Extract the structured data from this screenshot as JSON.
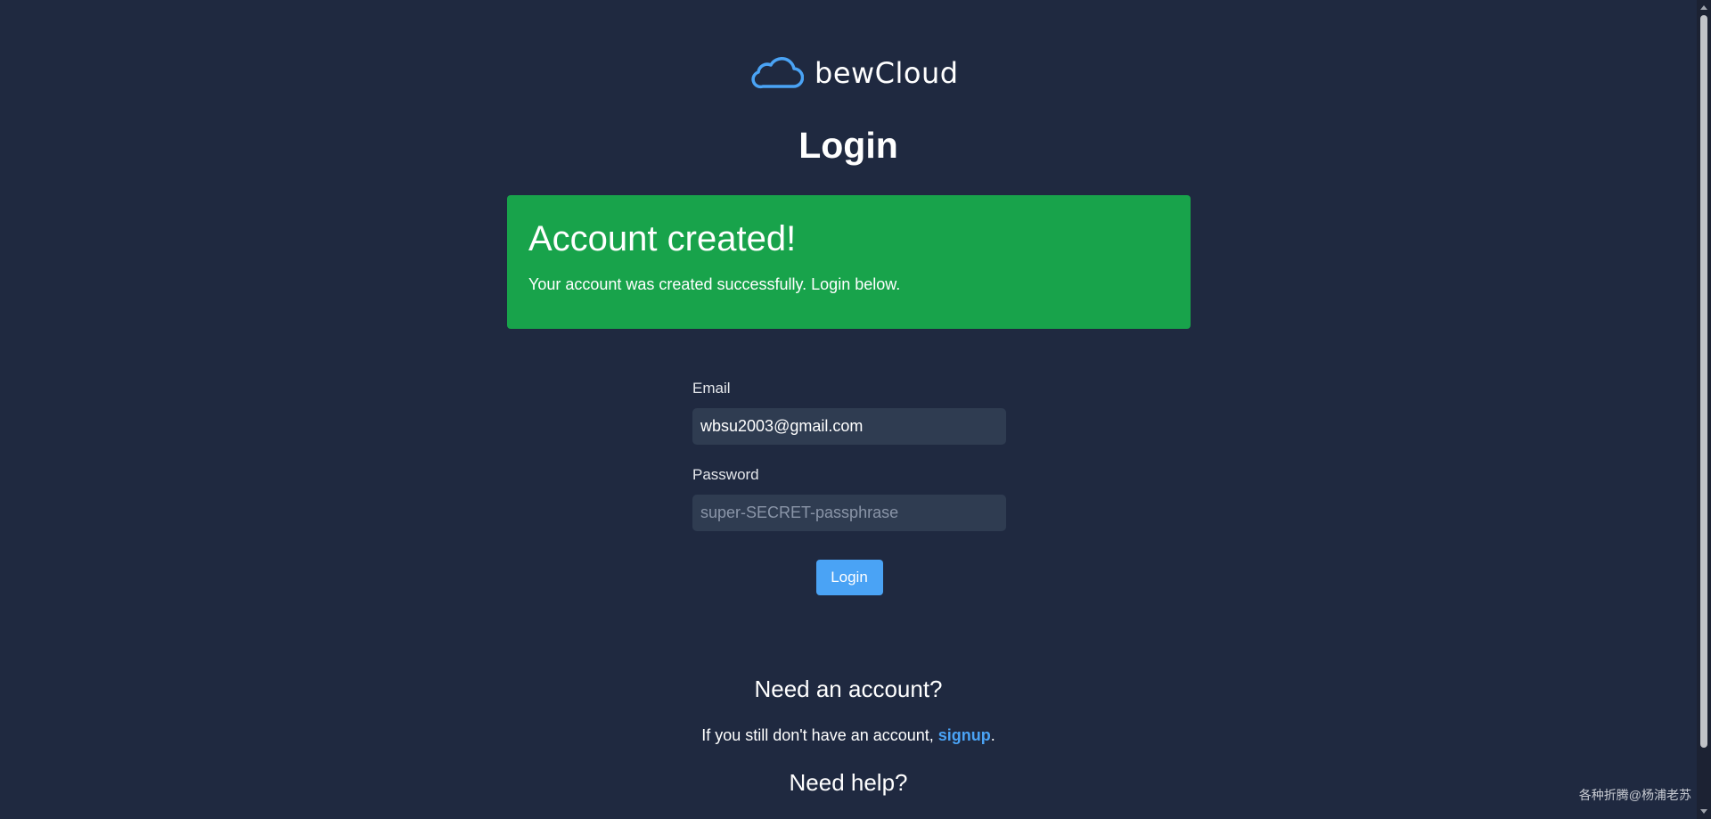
{
  "app": {
    "name": "bewCloud",
    "logo_icon": "cloud-icon",
    "brand_color": "#4aa3f5"
  },
  "page": {
    "title": "Login"
  },
  "notice": {
    "title": "Account created!",
    "message": "Your account was created successfully. Login below.",
    "color": "#18a34b"
  },
  "form": {
    "email_label": "Email",
    "email_value": "wbsu2003@gmail.com",
    "password_label": "Password",
    "password_placeholder": "super-SECRET-passphrase",
    "login_button": "Login"
  },
  "signup": {
    "heading": "Need an account?",
    "text_before": "If you still don't have an account, ",
    "link_text": "signup",
    "text_after": "."
  },
  "help": {
    "heading": "Need help?"
  },
  "watermark": "各种折腾@杨浦老苏"
}
